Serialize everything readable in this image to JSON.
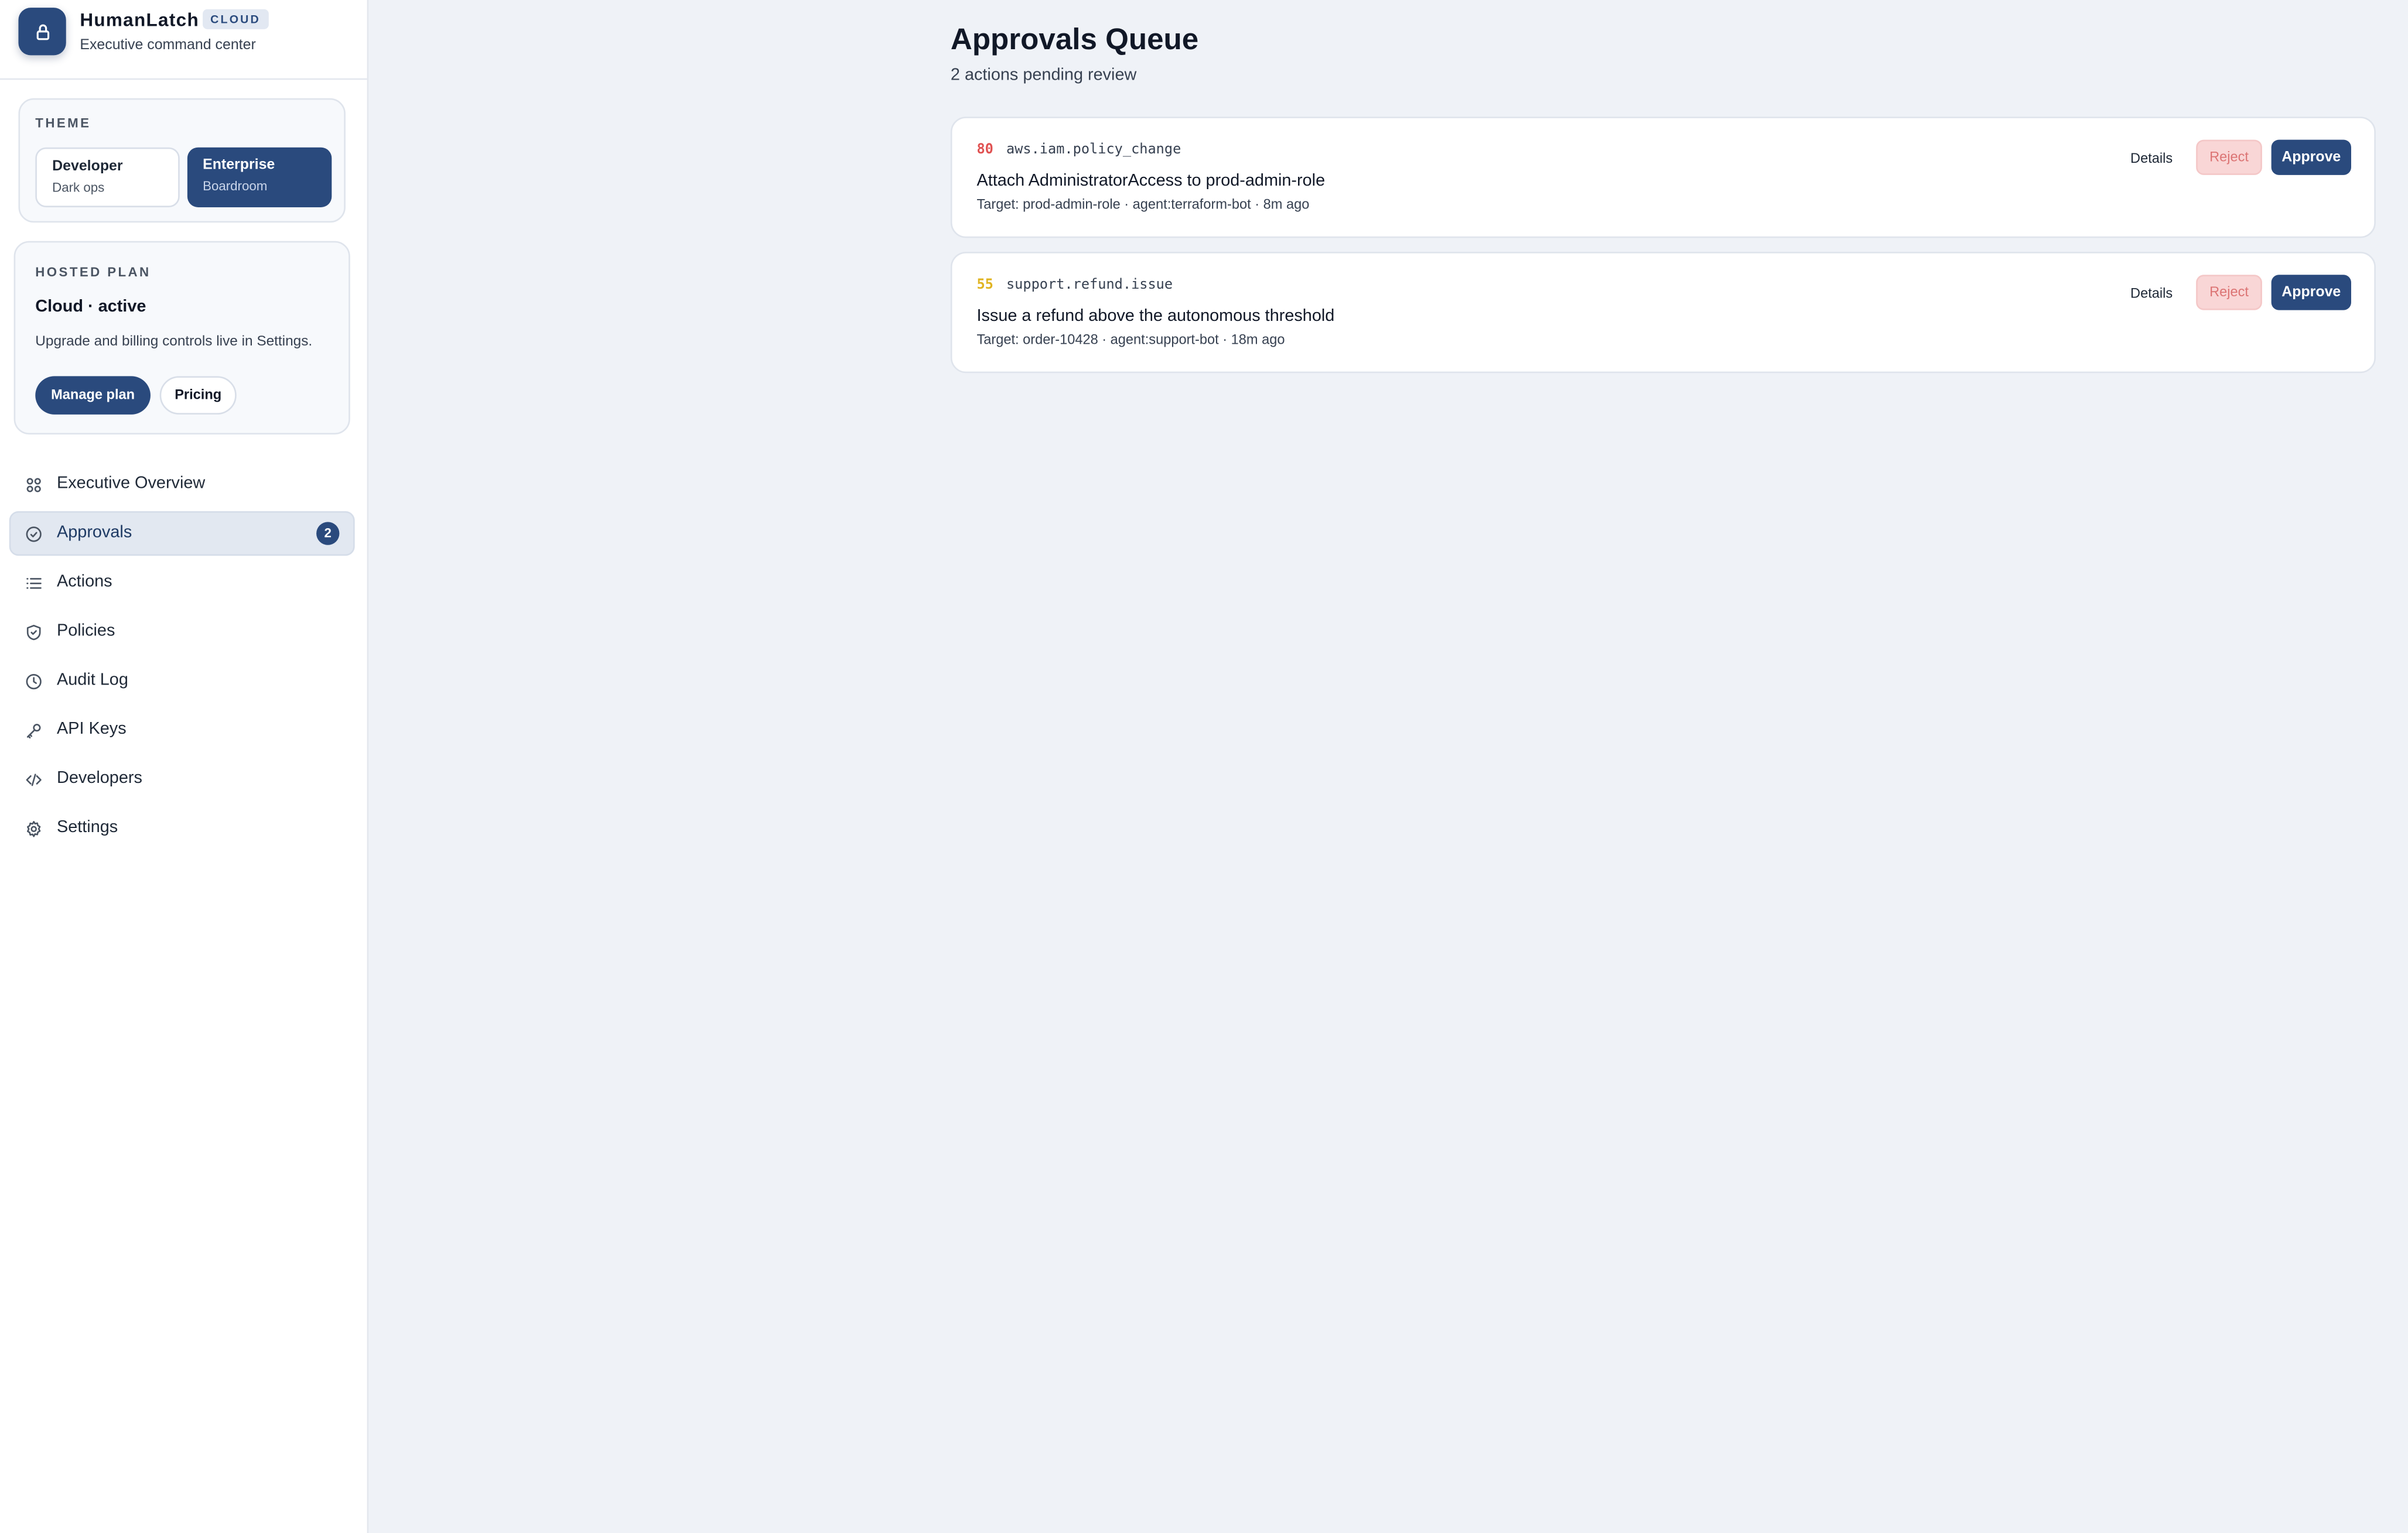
{
  "brand": {
    "name": "HumanLatch",
    "badge": "CLOUD",
    "tagline": "Executive command center",
    "logo_icon": "lock-icon"
  },
  "theme": {
    "title": "THEME",
    "options": [
      {
        "title": "Developer",
        "subtitle": "Dark ops",
        "selected": false
      },
      {
        "title": "Enterprise",
        "subtitle": "Boardroom",
        "selected": true
      }
    ]
  },
  "plan": {
    "title": "HOSTED PLAN",
    "status": "Cloud · active",
    "description": "Upgrade and billing controls live in Settings.",
    "manage_label": "Manage plan",
    "pricing_label": "Pricing"
  },
  "nav": {
    "items": [
      {
        "label": "Executive Overview",
        "icon": "grid-icon"
      },
      {
        "label": "Approvals",
        "icon": "check-circle-icon",
        "active": true,
        "count": "2"
      },
      {
        "label": "Actions",
        "icon": "list-icon"
      },
      {
        "label": "Policies",
        "icon": "shield-check-icon"
      },
      {
        "label": "Audit Log",
        "icon": "clock-icon"
      },
      {
        "label": "API Keys",
        "icon": "key-icon"
      },
      {
        "label": "Developers",
        "icon": "code-icon"
      },
      {
        "label": "Settings",
        "icon": "gear-icon"
      }
    ]
  },
  "main": {
    "title": "Approvals Queue",
    "subtitle": "2 actions pending review",
    "approvals": [
      {
        "risk_score": "80",
        "risk_color": "#e05252",
        "action_type": "aws.iam.policy_change",
        "title": "Attach AdministratorAccess to prod-admin-role",
        "meta": "Target: prod-admin-role · agent:terraform-bot · 8m ago",
        "details_label": "Details",
        "reject_label": "Reject",
        "approve_label": "Approve"
      },
      {
        "risk_score": "55",
        "risk_color": "#e0b422",
        "action_type": "support.refund.issue",
        "title": "Issue a refund above the autonomous threshold",
        "meta": "Target: order-10428 · agent:support-bot · 18m ago",
        "details_label": "Details",
        "reject_label": "Reject",
        "approve_label": "Approve"
      }
    ]
  },
  "colors": {
    "accent": "#2a4a7d",
    "background": "#eff2f7",
    "reject_bg": "#f9d6d6",
    "reject_text": "#dc7474"
  }
}
